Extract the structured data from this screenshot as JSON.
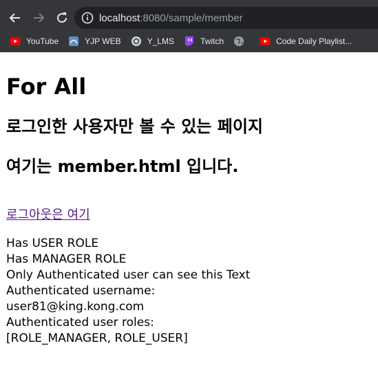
{
  "browser": {
    "url_host": "localhost",
    "url_rest": ":8080/sample/member",
    "bookmarks": [
      {
        "label": "YouTube",
        "icon": "youtube-icon"
      },
      {
        "label": "YJP WEB",
        "icon": "yjp-web-icon"
      },
      {
        "label": "Y_LMS",
        "icon": "y-lms-icon"
      },
      {
        "label": "Twitch",
        "icon": "twitch-icon"
      },
      {
        "label": "",
        "icon": "globe-icon"
      },
      {
        "label": "Code Daily Playlist...",
        "icon": "youtube-icon"
      }
    ],
    "colors": {
      "toolbar_bg": "#35363a",
      "omnibox_bg": "#202124",
      "text": "#e8eaed",
      "muted": "#9aa0a6",
      "youtube_red": "#ff0000",
      "twitch_purple": "#9146ff"
    }
  },
  "page": {
    "title": "For All",
    "subtitle": "로그인한 사용자만 볼 수 있는 페이지",
    "heading2": "여기는 member.html 입니다.",
    "logout_link": "로그아웃은 여기",
    "lines": [
      "Has USER ROLE",
      "Has MANAGER ROLE",
      "Only Authenticated user can see this Text",
      "Authenticated username:",
      "user81@king.kong.com",
      "Authenticated user roles:",
      "[ROLE_MANAGER, ROLE_USER]"
    ],
    "link_color": "#551a8b"
  }
}
